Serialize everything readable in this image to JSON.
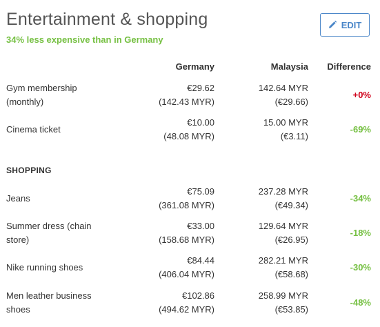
{
  "header": {
    "title": "Entertainment & shopping",
    "subtitle": "34% less expensive than in Germany",
    "edit_label": "EDIT"
  },
  "columns": {
    "germany": "Germany",
    "malaysia": "Malaysia",
    "difference": "Difference"
  },
  "entertainment_rows": [
    {
      "item": "Gym membership (monthly)",
      "germany": "€29.62",
      "germany_alt": "(142.43 MYR)",
      "malaysia": "142.64 MYR",
      "malaysia_alt": "(€29.66)",
      "difference": "+0%"
    },
    {
      "item": "Cinema ticket",
      "germany": "€10.00",
      "germany_alt": "(48.08 MYR)",
      "malaysia": "15.00 MYR",
      "malaysia_alt": "(€3.11)",
      "difference": "-69%"
    }
  ],
  "shopping_section": "SHOPPING",
  "shopping_rows": [
    {
      "item": "Jeans",
      "germany": "€75.09",
      "germany_alt": "(361.08 MYR)",
      "malaysia": "237.28 MYR",
      "malaysia_alt": "(€49.34)",
      "difference": "-34%"
    },
    {
      "item": "Summer dress (chain store)",
      "germany": "€33.00",
      "germany_alt": "(158.68 MYR)",
      "malaysia": "129.64 MYR",
      "malaysia_alt": "(€26.95)",
      "difference": "-18%"
    },
    {
      "item": "Nike running shoes",
      "germany": "€84.44",
      "germany_alt": "(406.04 MYR)",
      "malaysia": "282.21 MYR",
      "malaysia_alt": "(€58.68)",
      "difference": "-30%"
    },
    {
      "item": "Men leather business shoes",
      "germany": "€102.86",
      "germany_alt": "(494.62 MYR)",
      "malaysia": "258.99 MYR",
      "malaysia_alt": "(€53.85)",
      "difference": "-48%"
    }
  ],
  "colors": {
    "accent_green": "#76c043",
    "increase_red": "#d0021b",
    "button_blue": "#4a86c8"
  },
  "icons": {
    "edit": "pencil-icon"
  }
}
